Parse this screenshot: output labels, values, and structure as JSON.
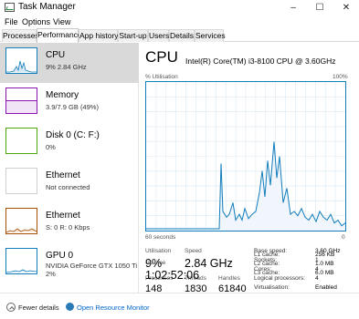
{
  "window": {
    "title": "Task Manager",
    "minimize": "–",
    "maximize": "☐",
    "close": "✕"
  },
  "menu": [
    "File",
    "Options",
    "View"
  ],
  "tabs": [
    "Processes",
    "Performance",
    "App history",
    "Start-up",
    "Users",
    "Details",
    "Services"
  ],
  "active_tab": "Performance",
  "sidebar": [
    {
      "name": "CPU",
      "sub1": "9% 2.84 GHz",
      "sub2": "",
      "color": "#117dbb",
      "selected": true
    },
    {
      "name": "Memory",
      "sub1": "3.9/7.9 GB (49%)",
      "sub2": "",
      "color": "#8b12ae",
      "selected": false
    },
    {
      "name": "Disk 0 (C: F:)",
      "sub1": "0%",
      "sub2": "",
      "color": "#4da60c",
      "selected": false
    },
    {
      "name": "Ethernet",
      "sub1": "Not connected",
      "sub2": "",
      "color": "#a74f01",
      "selected": false
    },
    {
      "name": "Ethernet",
      "sub1": "S: 0 R: 0 Kbps",
      "sub2": "",
      "color": "#a74f01",
      "selected": false
    },
    {
      "name": "GPU 0",
      "sub1": "NVIDIA GeForce GTX 1050 Ti",
      "sub2": "2%",
      "color": "#117dbb",
      "selected": false
    }
  ],
  "main": {
    "title": "CPU",
    "model": "Intel(R) Core(TM) i3-8100 CPU @ 3.60GHz",
    "graph_label_left": "% Utilisation",
    "graph_label_right": "100%",
    "graph_foot_left": "60 seconds",
    "graph_foot_right": "0",
    "stats": {
      "utilisation_label": "Utilisation",
      "utilisation": "9%",
      "speed_label": "Speed",
      "speed": "2.84 GHz",
      "processes_label": "Processes",
      "processes": "148",
      "threads_label": "Threads",
      "threads": "1830",
      "handles_label": "Handles",
      "handles": "61840",
      "uptime_label": "Up time",
      "uptime": "1:02:52:06"
    },
    "specs": [
      {
        "label": "Base speed:",
        "value": "3.60 GHz"
      },
      {
        "label": "Sockets:",
        "value": "1"
      },
      {
        "label": "Cores:",
        "value": "4"
      },
      {
        "label": "Logical processors:",
        "value": "4"
      },
      {
        "label": "Virtualisation:",
        "value": "Enabled"
      },
      {
        "label": "L1 cache:",
        "value": "256 KB"
      },
      {
        "label": "L2 cache:",
        "value": "1.0 MB"
      },
      {
        "label": "L3 cache:",
        "value": "6.0 MB"
      }
    ]
  },
  "footer": {
    "fewer": "Fewer details",
    "open_monitor": "Open Resource Monitor"
  },
  "cpu_history": [
    0,
    0,
    0,
    0,
    0,
    0,
    0,
    0,
    0,
    0,
    0,
    0,
    0,
    0,
    0,
    0,
    0,
    0,
    0,
    0,
    0,
    0,
    0,
    0,
    0,
    0,
    0,
    0,
    0,
    0,
    0,
    0,
    0,
    0,
    0,
    0,
    0,
    0,
    0,
    0,
    0,
    0,
    0,
    0,
    0,
    0,
    0,
    0,
    0,
    0,
    0,
    0,
    0,
    0,
    0,
    0,
    0,
    0,
    0,
    0,
    0,
    0,
    0,
    0,
    0,
    0,
    0,
    0,
    0,
    0,
    0,
    0,
    0,
    0,
    0,
    0,
    0,
    0,
    0,
    0,
    0,
    0,
    0,
    0,
    0,
    0,
    0,
    0,
    0,
    0,
    0,
    0,
    0,
    0,
    0,
    0,
    0,
    0,
    0,
    0,
    0,
    0,
    0,
    0,
    0,
    0,
    0,
    0,
    0,
    0,
    0,
    0,
    0,
    0,
    0,
    0,
    0,
    0,
    0,
    0,
    0,
    0,
    0,
    0,
    0,
    0,
    0,
    0,
    0,
    0,
    0,
    0,
    0,
    0,
    0,
    0,
    0,
    0,
    0,
    0,
    0,
    0,
    0,
    0,
    0,
    0,
    0,
    0,
    0,
    0,
    0,
    0,
    0,
    0,
    0,
    0,
    0,
    0,
    0,
    0,
    0,
    0,
    0,
    0,
    0,
    0,
    0,
    0,
    0,
    0,
    0,
    0,
    0,
    0,
    0,
    0,
    0,
    0,
    0,
    0,
    0,
    0,
    0,
    0,
    0,
    0,
    0,
    0,
    0,
    0,
    0,
    0,
    0,
    0,
    0,
    0,
    0,
    0,
    0,
    0
  ],
  "accent": "#117dbb"
}
